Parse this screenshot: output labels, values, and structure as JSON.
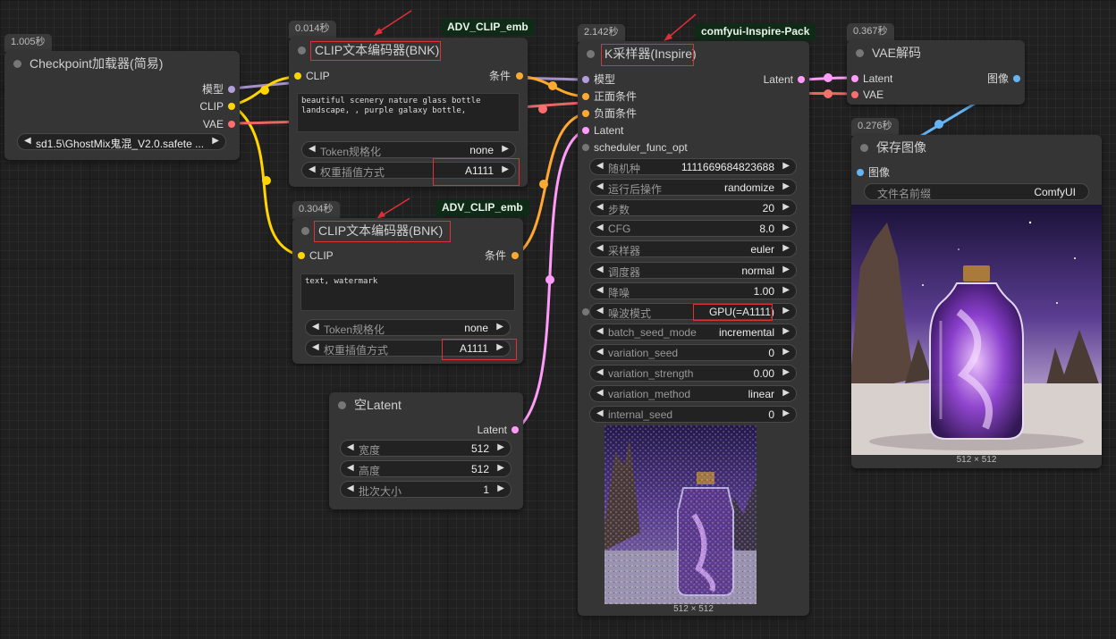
{
  "nodes": {
    "checkpoint": {
      "timing": "1.005秒",
      "title": "Checkpoint加载器(简易)",
      "outputs": [
        "模型",
        "CLIP",
        "VAE"
      ],
      "ckpt_value": "sd1.5\\GhostMix鬼混_V2.0.safete ..."
    },
    "clip1": {
      "timing": "0.014秒",
      "badge": "ADV_CLIP_emb",
      "title": "CLIP文本编码器(BNK)",
      "input": "CLIP",
      "output": "条件",
      "text": "beautiful scenery nature glass bottle landscape, , purple galaxy bottle,",
      "token_label": "Token规格化",
      "token_value": "none",
      "weight_label": "权重插值方式",
      "weight_value": "A1111"
    },
    "clip2": {
      "timing": "0.304秒",
      "badge": "ADV_CLIP_emb",
      "title": "CLIP文本编码器(BNK)",
      "input": "CLIP",
      "output": "条件",
      "text": "text, watermark",
      "token_label": "Token规格化",
      "token_value": "none",
      "weight_label": "权重插值方式",
      "weight_value": "A1111"
    },
    "latent": {
      "title": "空Latent",
      "output": "Latent",
      "width_label": "宽度",
      "width_value": "512",
      "height_label": "高度",
      "height_value": "512",
      "batch_label": "批次大小",
      "batch_value": "1"
    },
    "ksampler": {
      "timing": "2.142秒",
      "badge": "comfyui-Inspire-Pack",
      "title": "K采样器(Inspire)",
      "inputs": [
        "模型",
        "正面条件",
        "负面条件",
        "Latent",
        "scheduler_func_opt"
      ],
      "output": "Latent",
      "widgets": [
        {
          "label": "随机种",
          "value": "1111669684823688"
        },
        {
          "label": "运行后操作",
          "value": "randomize"
        },
        {
          "label": "步数",
          "value": "20"
        },
        {
          "label": "CFG",
          "value": "8.0"
        },
        {
          "label": "采样器",
          "value": "euler"
        },
        {
          "label": "调度器",
          "value": "normal"
        },
        {
          "label": "降噪",
          "value": "1.00"
        },
        {
          "label": "噪波模式",
          "value": "GPU(=A1111)"
        },
        {
          "label": "batch_seed_mode",
          "value": "incremental"
        },
        {
          "label": "variation_seed",
          "value": "0"
        },
        {
          "label": "variation_strength",
          "value": "0.00"
        },
        {
          "label": "variation_method",
          "value": "linear"
        },
        {
          "label": "internal_seed",
          "value": "0"
        }
      ],
      "preview_caption": "512 × 512"
    },
    "vae": {
      "timing": "0.367秒",
      "title": "VAE解码",
      "inputs": [
        "Latent",
        "VAE"
      ],
      "output": "图像"
    },
    "save": {
      "timing": "0.276秒",
      "title": "保存图像",
      "input": "图像",
      "prefix_label": "文件名前缀",
      "prefix_value": "ComfyUI",
      "caption": "512 × 512"
    }
  },
  "colors": {
    "model": "#b39ddb",
    "clip": "#ffd500",
    "vae": "#ff6e6e",
    "conditioning": "#ffa931",
    "latent": "#ff9cf9",
    "image": "#64b5f6",
    "highlight": "#e0303a"
  }
}
